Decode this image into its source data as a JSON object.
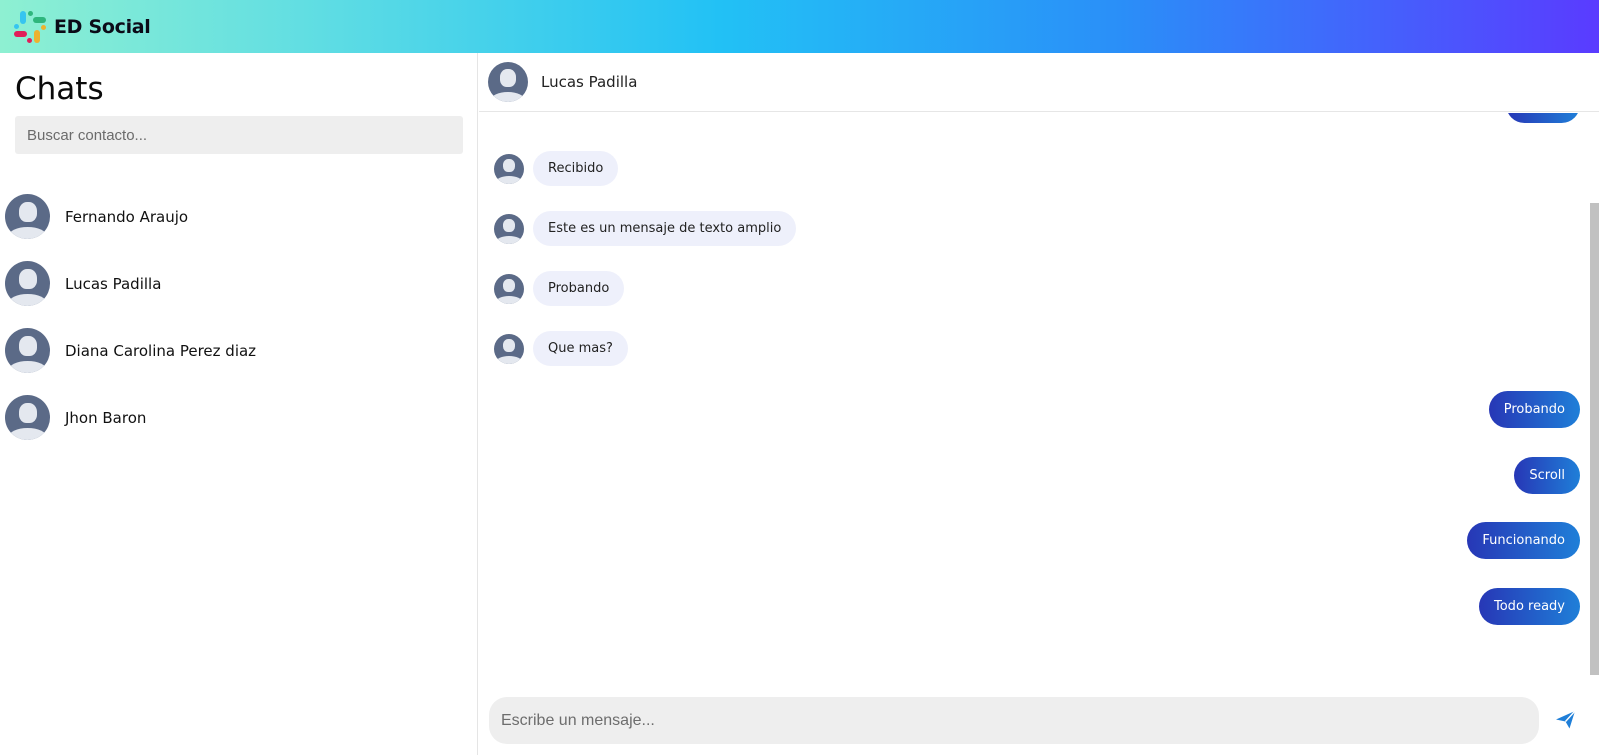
{
  "app": {
    "brand": "ED Social",
    "logo_icon": "slack-style-logo-icon"
  },
  "colors": {
    "accent_start": "#2737b6",
    "accent_end": "#1f7fd8",
    "incoming_bubble": "#eef0fb",
    "avatar_bg": "#5b6a87"
  },
  "sidebar": {
    "title": "Chats",
    "search": {
      "placeholder": "Buscar contacto...",
      "value": ""
    },
    "contacts": [
      {
        "name": "Fernando Araujo"
      },
      {
        "name": "Lucas Padilla"
      },
      {
        "name": "Diana Carolina Perez diaz"
      },
      {
        "name": "Jhon Baron"
      }
    ]
  },
  "chat": {
    "contact_name": "Lucas Padilla",
    "incoming": [
      {
        "text": "Recibido"
      },
      {
        "text": "Este es un mensaje de texto amplio"
      },
      {
        "text": "Probando"
      },
      {
        "text": "Que mas?"
      }
    ],
    "outgoing": [
      {
        "text": "Probando"
      },
      {
        "text": "Scroll"
      },
      {
        "text": "Funcionando"
      },
      {
        "text": "Todo ready"
      }
    ],
    "composer": {
      "placeholder": "Escribe un mensaje...",
      "value": ""
    },
    "send_icon": "paper-plane-icon"
  }
}
